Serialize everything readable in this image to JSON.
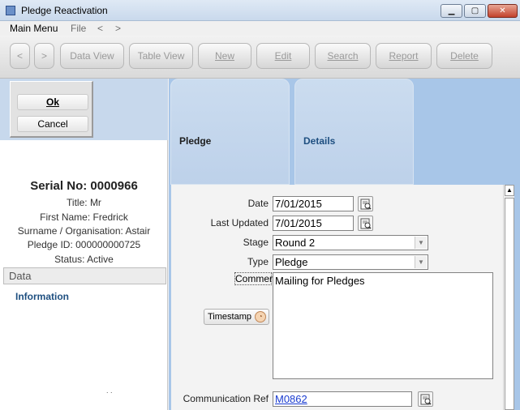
{
  "window": {
    "title": "Pledge Reactivation",
    "controls": {
      "minimize": "▁",
      "maximize": "▢",
      "close": "✕"
    }
  },
  "menu": {
    "main": "Main Menu",
    "file": "File",
    "back": "<",
    "forward": ">"
  },
  "toolbar": {
    "prev": "<",
    "next": ">",
    "data_view": "Data View",
    "table_view": "Table View",
    "new": "New",
    "edit": "Edit",
    "search": "Search",
    "report": "Report",
    "delete": "Delete"
  },
  "dialog": {
    "ok": "Ok",
    "cancel": "Cancel"
  },
  "record": {
    "serial": "Serial No: 0000966",
    "title": "Title: Mr",
    "first_name": "First Name: Fredrick",
    "surname": "Surname / Organisation: Astair",
    "pledge_id": "Pledge ID: 000000000725",
    "status": "Status: Active"
  },
  "sidebar": {
    "header": "Data",
    "items": [
      {
        "label": "Information"
      }
    ],
    "footer_dots": ". ."
  },
  "tabs": [
    {
      "label": "Pledge"
    },
    {
      "label": "Details"
    }
  ],
  "form": {
    "date": {
      "label": "Date",
      "value": "7/01/2015"
    },
    "last_updated": {
      "label": "Last Updated",
      "value": "7/01/2015"
    },
    "stage": {
      "label": "Stage",
      "value": "Round 2"
    },
    "type": {
      "label": "Type",
      "value": "Pledge"
    },
    "comment": {
      "label": "Comment",
      "value": "Mailing for Pledges"
    },
    "timestamp": {
      "label": "Timestamp"
    },
    "communication_ref": {
      "label": "Communication Ref",
      "value": "M0862"
    }
  },
  "icons": {
    "calendar": "calendar-lookup-icon",
    "dropdown": "▼",
    "timestamp": "◔",
    "scroll_up": "▲"
  }
}
